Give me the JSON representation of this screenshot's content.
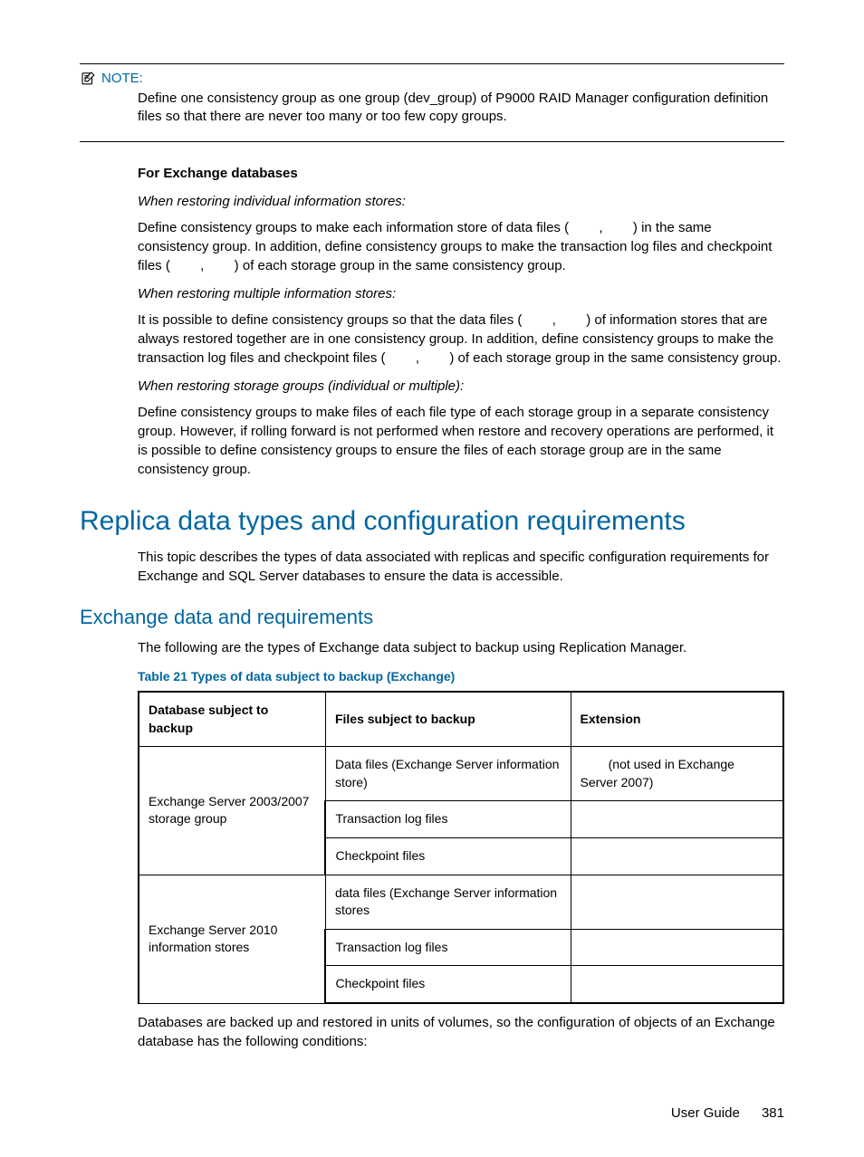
{
  "note": {
    "label": "NOTE:",
    "body": "Define one consistency group as one group (dev_group) of P9000 RAID Manager configuration definition files so that there are never too many or too few copy groups."
  },
  "exchange_section": {
    "heading": "For Exchange databases",
    "sub1": "When restoring individual information stores:",
    "p1": "Define consistency groups to make each information store of data files (        ,        ) in the same consistency group. In addition, define consistency groups to make the transaction log files and checkpoint files (        ,        ) of each storage group in the same consistency group.",
    "sub2": "When restoring multiple information stores:",
    "p2": "It is possible to define consistency groups so that the data files (        ,        ) of information stores that are always restored together are in one consistency group. In addition, define consistency groups to make the transaction log files and checkpoint files (        ,        ) of each storage group in the same consistency group.",
    "sub3": "When restoring storage groups (individual or multiple):",
    "p3": "Define consistency groups to make files of each file type of each storage group in a separate consistency group. However, if rolling forward is not performed when restore and recovery operations are performed, it is possible to define consistency groups to ensure the files of each storage group are in the same consistency group."
  },
  "h1": "Replica data types and configuration requirements",
  "h1_intro": "This topic describes the types of data associated with replicas and specific configuration requirements for Exchange and SQL Server databases to ensure the data is accessible.",
  "h2": "Exchange data and requirements",
  "h2_intro": "The following are the types of Exchange data subject to backup using Replication Manager.",
  "table_caption": "Table 21 Types of data subject to backup (Exchange)",
  "table": {
    "headers": [
      "Database subject to backup",
      "Files subject to backup",
      "Extension"
    ],
    "rows": [
      {
        "db": "Exchange Server 2003/2007 storage group",
        "files": "Data files (Exchange Server information store)",
        "ext": "        (not used in Exchange Server 2007)",
        "rowspan": 3
      },
      {
        "files": "Transaction log files",
        "ext": ""
      },
      {
        "files": "Checkpoint files",
        "ext": ""
      },
      {
        "db": "Exchange Server 2010 information stores",
        "files": "data files (Exchange Server information stores",
        "ext": "",
        "rowspan": 3
      },
      {
        "files": "Transaction log files",
        "ext": ""
      },
      {
        "files": "Checkpoint files",
        "ext": ""
      }
    ]
  },
  "after_table": "Databases are backed up and restored in units of volumes, so the configuration of objects of an Exchange database has the following conditions:",
  "footer": {
    "label": "User Guide",
    "page": "381"
  }
}
